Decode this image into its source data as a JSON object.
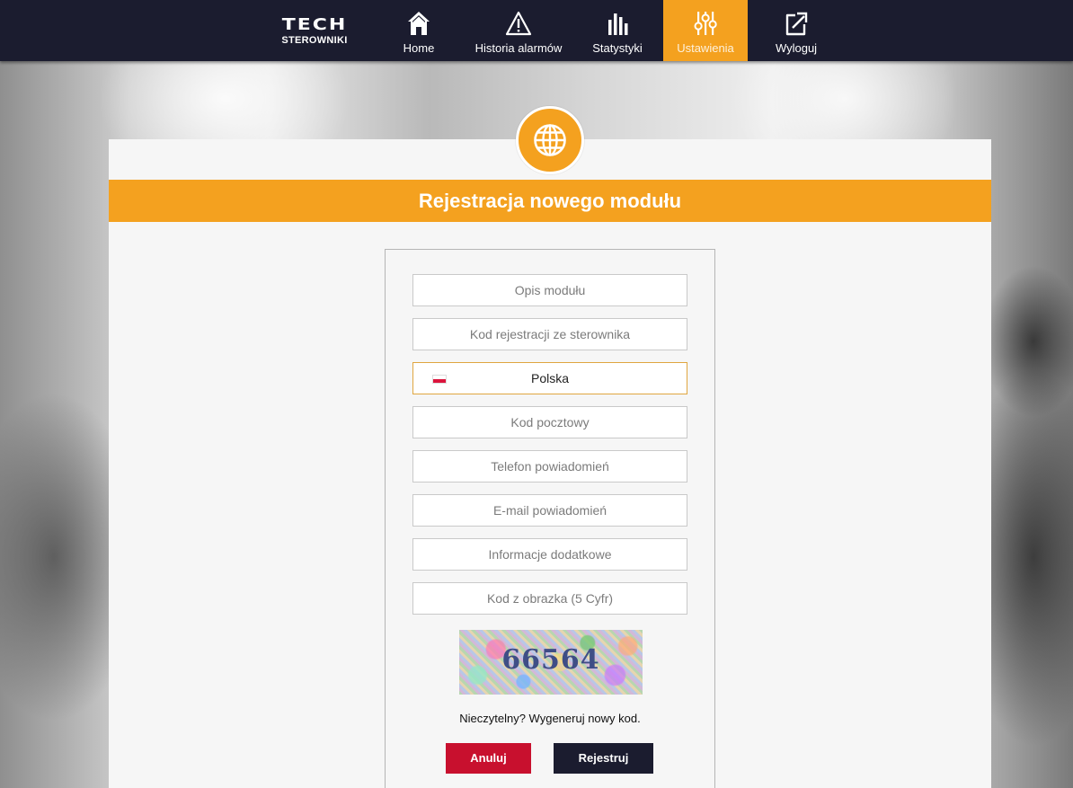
{
  "brand": {
    "logo_main": "TECH",
    "logo_sub": "STEROWNIKI"
  },
  "nav": {
    "items": [
      {
        "label": "Home",
        "icon": "home-icon"
      },
      {
        "label": "Historia alarmów",
        "icon": "alarm-triangle-icon"
      },
      {
        "label": "Statystyki",
        "icon": "bar-chart-icon"
      },
      {
        "label": "Ustawienia",
        "icon": "sliders-icon",
        "active": true
      },
      {
        "label": "Wyloguj",
        "icon": "logout-icon"
      }
    ]
  },
  "panel": {
    "title": "Rejestracja nowego modułu",
    "badge_icon": "globe-icon"
  },
  "form": {
    "module_description": {
      "placeholder": "Opis modułu",
      "value": ""
    },
    "registration_code": {
      "placeholder": "Kod rejestracji ze sterownika",
      "value": ""
    },
    "country": {
      "value": "Polska",
      "flag": "poland-flag-icon"
    },
    "postal_code": {
      "placeholder": "Kod pocztowy",
      "value": ""
    },
    "notification_phone": {
      "placeholder": "Telefon powiadomień",
      "value": ""
    },
    "notification_email": {
      "placeholder": "E-mail powiadomień",
      "value": ""
    },
    "additional_info": {
      "placeholder": "Informacje dodatkowe",
      "value": ""
    },
    "captcha_code": {
      "placeholder": "Kod z obrazka (5 Cyfr)",
      "value": ""
    },
    "captcha_image_text": "66564",
    "regenerate_link": "Nieczytelny? Wygeneruj nowy kod.",
    "cancel_label": "Anuluj",
    "register_label": "Rejestruj"
  },
  "colors": {
    "accent": "#f4a11f",
    "navbar": "#1b1c2f",
    "cancel": "#c8102e"
  }
}
